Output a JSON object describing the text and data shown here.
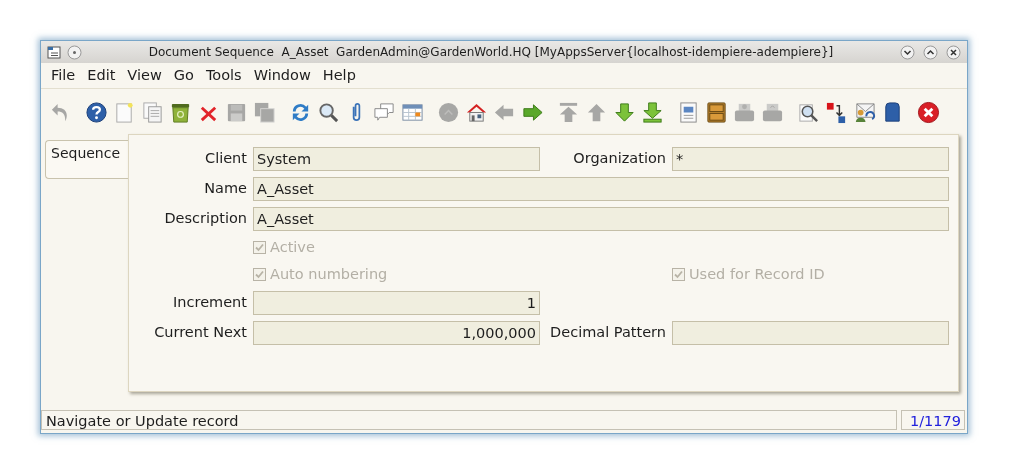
{
  "window": {
    "title": "Document Sequence  A_Asset  GardenAdmin@GardenWorld.HQ [MyAppsServer{localhost-idempiere-adempiere}]"
  },
  "menu": [
    {
      "label": "File"
    },
    {
      "label": "Edit"
    },
    {
      "label": "View"
    },
    {
      "label": "Go"
    },
    {
      "label": "Tools"
    },
    {
      "label": "Window"
    },
    {
      "label": "Help"
    }
  ],
  "toolbar": [
    [
      {
        "kind": "undo",
        "disabled": true
      }
    ],
    [
      {
        "kind": "help",
        "disabled": false
      },
      {
        "kind": "new",
        "disabled": false
      },
      {
        "kind": "copy",
        "disabled": false
      },
      {
        "kind": "trash",
        "disabled": false
      },
      {
        "kind": "delete",
        "disabled": false
      },
      {
        "kind": "save",
        "disabled": true
      },
      {
        "kind": "saveall",
        "disabled": true
      }
    ],
    [
      {
        "kind": "refresh",
        "disabled": false
      },
      {
        "kind": "find",
        "disabled": false
      },
      {
        "kind": "attach",
        "disabled": false
      },
      {
        "kind": "chat",
        "disabled": false
      },
      {
        "kind": "grid",
        "disabled": false
      }
    ],
    [
      {
        "kind": "history",
        "disabled": true
      },
      {
        "kind": "home",
        "disabled": false
      },
      {
        "kind": "prev",
        "disabled": true
      },
      {
        "kind": "next",
        "disabled": false
      }
    ],
    [
      {
        "kind": "first",
        "disabled": true
      },
      {
        "kind": "up",
        "disabled": true
      },
      {
        "kind": "down",
        "disabled": false
      },
      {
        "kind": "last",
        "disabled": false
      }
    ],
    [
      {
        "kind": "report",
        "disabled": false
      },
      {
        "kind": "archive",
        "disabled": false
      },
      {
        "kind": "print",
        "disabled": true
      },
      {
        "kind": "preview",
        "disabled": true
      }
    ],
    [
      {
        "kind": "zoom",
        "disabled": false
      },
      {
        "kind": "translate",
        "disabled": false
      },
      {
        "kind": "workflow",
        "disabled": false
      },
      {
        "kind": "product",
        "disabled": false
      }
    ],
    [
      {
        "kind": "exit",
        "disabled": false
      }
    ]
  ],
  "tabs": [
    {
      "label": "Sequence",
      "selected": true
    }
  ],
  "form": {
    "rows": [
      {
        "fields": [
          {
            "kind": "text",
            "label": "Client",
            "value": "System"
          },
          {
            "kind": "text",
            "label": "Organization",
            "value": "*"
          }
        ]
      },
      {
        "fields": [
          {
            "kind": "wide_text",
            "label": "Name",
            "value": "A_Asset"
          }
        ]
      },
      {
        "fields": [
          {
            "kind": "wide_text",
            "label": "Description",
            "value": "A_Asset"
          }
        ]
      },
      {
        "fields": [
          {
            "kind": "checkbox",
            "label": "Active",
            "checked": true,
            "disabled": true
          }
        ]
      },
      {
        "fields": [
          {
            "kind": "checkbox",
            "label": "Auto numbering",
            "checked": true,
            "disabled": true
          },
          {
            "kind": "checkbox",
            "label": "Used for Record ID",
            "checked": true,
            "disabled": true
          }
        ]
      },
      {
        "fields": [
          {
            "kind": "number",
            "label": "Increment",
            "value": "1"
          }
        ]
      },
      {
        "fields": [
          {
            "kind": "number",
            "label": "Current Next",
            "value": "1,000,000"
          },
          {
            "kind": "text",
            "label": "Decimal Pattern"
          }
        ]
      }
    ]
  },
  "status_bar": {
    "message": "Navigate or Update record",
    "record": "1/1179"
  }
}
